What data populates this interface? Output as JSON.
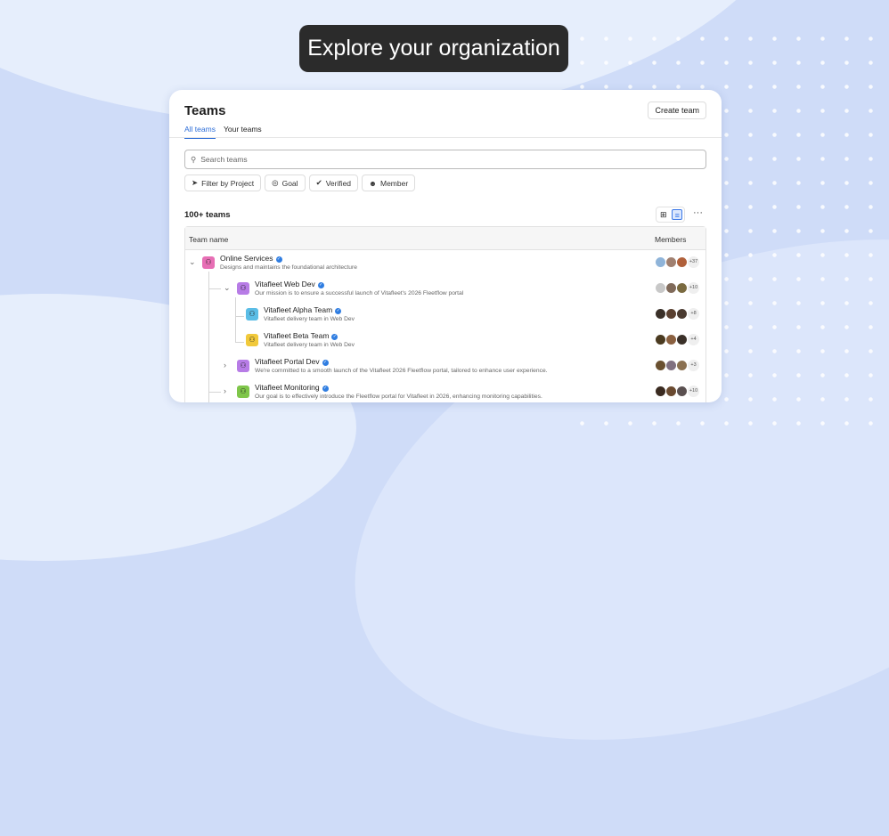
{
  "banner": "Explore your organization",
  "page": {
    "title": "Teams",
    "create_label": "Create team",
    "tabs": [
      {
        "label": "All teams",
        "active": true
      },
      {
        "label": "Your teams",
        "active": false
      }
    ],
    "search_placeholder": "Search teams",
    "filters": [
      {
        "label": "Filter by Project",
        "icon": "rocket-icon"
      },
      {
        "label": "Goal",
        "icon": "target-icon"
      },
      {
        "label": "Verified",
        "icon": "verified-icon"
      },
      {
        "label": "Member",
        "icon": "person-icon"
      }
    ],
    "count": "100+ teams",
    "columns": {
      "name": "Team name",
      "members": "Members"
    },
    "accent": "#2f6fd8",
    "teams": [
      {
        "name": "Online Services",
        "desc": "Designs and maintains the foundational architecture",
        "extra": "+37",
        "color": "#e76fb5",
        "expand": "expanded"
      },
      {
        "name": "Vitafleet Web Dev",
        "desc": "Our mission is to ensure a successful launch of Vitafleet's 2026 Fleetflow portal",
        "extra": "+10",
        "color": "#b77ce6",
        "expand": "expanded"
      },
      {
        "name": "Vitafleet Alpha Team",
        "desc": "Vitafleet delivery team in Web Dev",
        "extra": "+8",
        "color": "#5bbde6",
        "expand": "none"
      },
      {
        "name": "Vitafleet Beta Team",
        "desc": "Vitafleet delivery team in Web Dev",
        "extra": "+4",
        "color": "#f1c93b",
        "expand": "none"
      },
      {
        "name": "Vitafleet Portal Dev",
        "desc": "We're committed to a smooth launch of the Vitafleet 2026 Fleetflow portal, tailored to enhance user experience.",
        "extra": "+3",
        "color": "#b77ce6",
        "expand": "collapsed"
      },
      {
        "name": "Vitafleet Monitoring",
        "desc": "Our goal is to effectively introduce the Fleetflow portal for Vitafleet in 2026, enhancing monitoring capabilities.",
        "extra": "+10",
        "color": "#7fc64a",
        "expand": "collapsed"
      }
    ]
  }
}
